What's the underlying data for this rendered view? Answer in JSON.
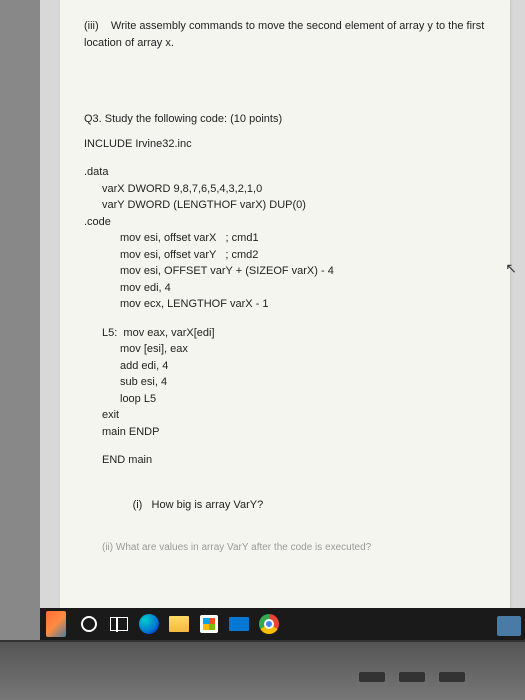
{
  "paper": {
    "iii": {
      "label": "(iii)",
      "text": "Write assembly commands to move the second element of array y to the first location of array x."
    },
    "q3": {
      "heading": "Q3. Study the following code: (10 points)",
      "include": "INCLUDE Irvine32.inc",
      "data_label": ".data",
      "varX": "varX DWORD 9,8,7,6,5,4,3,2,1,0",
      "varY": "varY DWORD (LENGTHOF varX) DUP(0)",
      "code_label": ".code",
      "lines": {
        "l1": "mov esi, offset varX   ; cmd1",
        "l2": "mov esi, offset varY   ; cmd2",
        "l3": "mov esi, OFFSET varY + (SIZEOF varX) - 4",
        "l4": "mov edi, 4",
        "l5": "mov ecx, LENGTHOF varX - 1"
      },
      "l5label": "L5:",
      "loop": {
        "b1": "mov eax, varX[edi]",
        "b2": "mov [esi], eax",
        "b3": "add edi, 4",
        "b4": "sub esi, 4",
        "b5": "loop L5"
      },
      "exit": "exit",
      "endp": "main ENDP",
      "endmain": "END main",
      "qi": {
        "label": "(i)",
        "text": "How big is array VarY?"
      },
      "qii_faded": "(ii)   What are values in array VarY after the code is executed?"
    }
  },
  "taskbar": {
    "items": [
      "weather",
      "start-circle",
      "cortana",
      "task-view",
      "edge",
      "explorer",
      "store",
      "mail",
      "chrome"
    ]
  }
}
